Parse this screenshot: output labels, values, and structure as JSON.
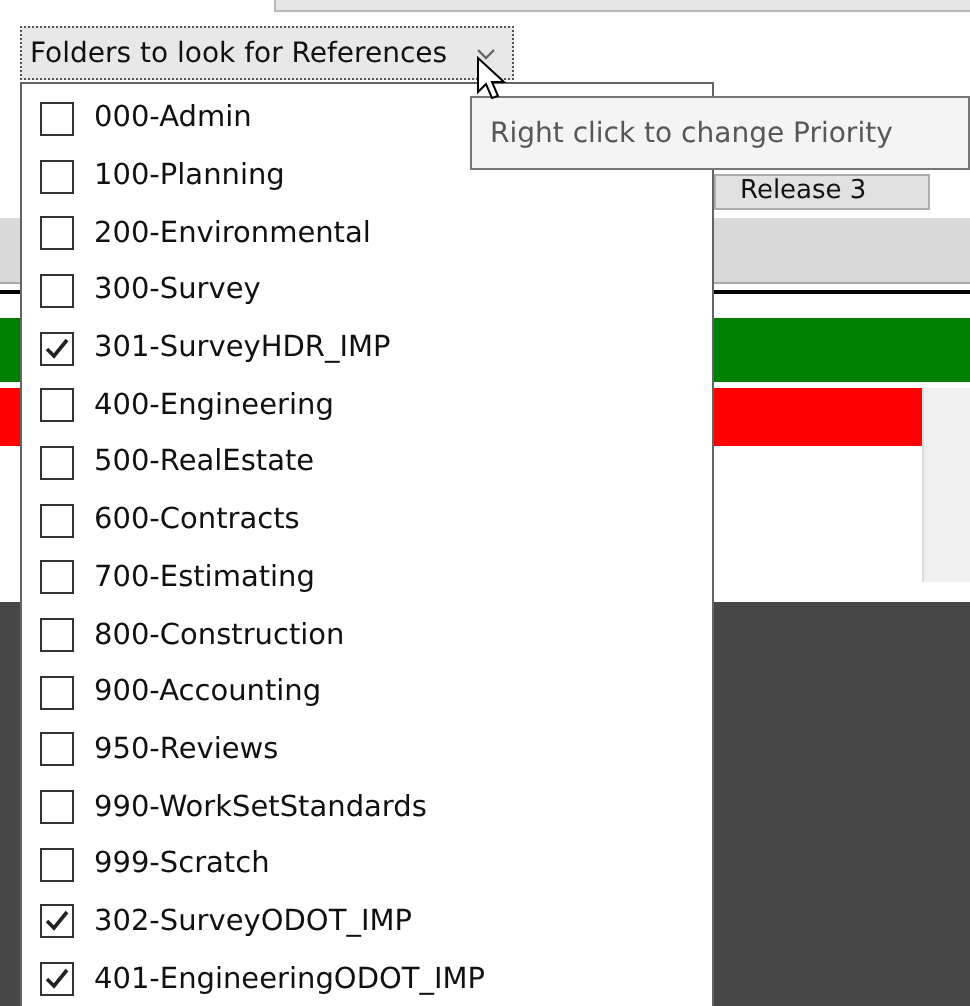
{
  "dropdown": {
    "label": "Folders to look for References",
    "expanded": true
  },
  "tooltip": "Right click to change Priority",
  "background_button": "Release 3",
  "folders": [
    {
      "label": "000-Admin",
      "checked": false
    },
    {
      "label": "100-Planning",
      "checked": false
    },
    {
      "label": "200-Environmental",
      "checked": false
    },
    {
      "label": "300-Survey",
      "checked": false
    },
    {
      "label": "301-SurveyHDR_IMP",
      "checked": true
    },
    {
      "label": "400-Engineering",
      "checked": false
    },
    {
      "label": "500-RealEstate",
      "checked": false
    },
    {
      "label": "600-Contracts",
      "checked": false
    },
    {
      "label": "700-Estimating",
      "checked": false
    },
    {
      "label": "800-Construction",
      "checked": false
    },
    {
      "label": "900-Accounting",
      "checked": false
    },
    {
      "label": "950-Reviews",
      "checked": false
    },
    {
      "label": "990-WorkSetStandards",
      "checked": false
    },
    {
      "label": "999-Scratch",
      "checked": false
    },
    {
      "label": "302-SurveyODOT_IMP",
      "checked": true
    },
    {
      "label": "401-EngineeringODOT_IMP",
      "checked": true
    }
  ]
}
